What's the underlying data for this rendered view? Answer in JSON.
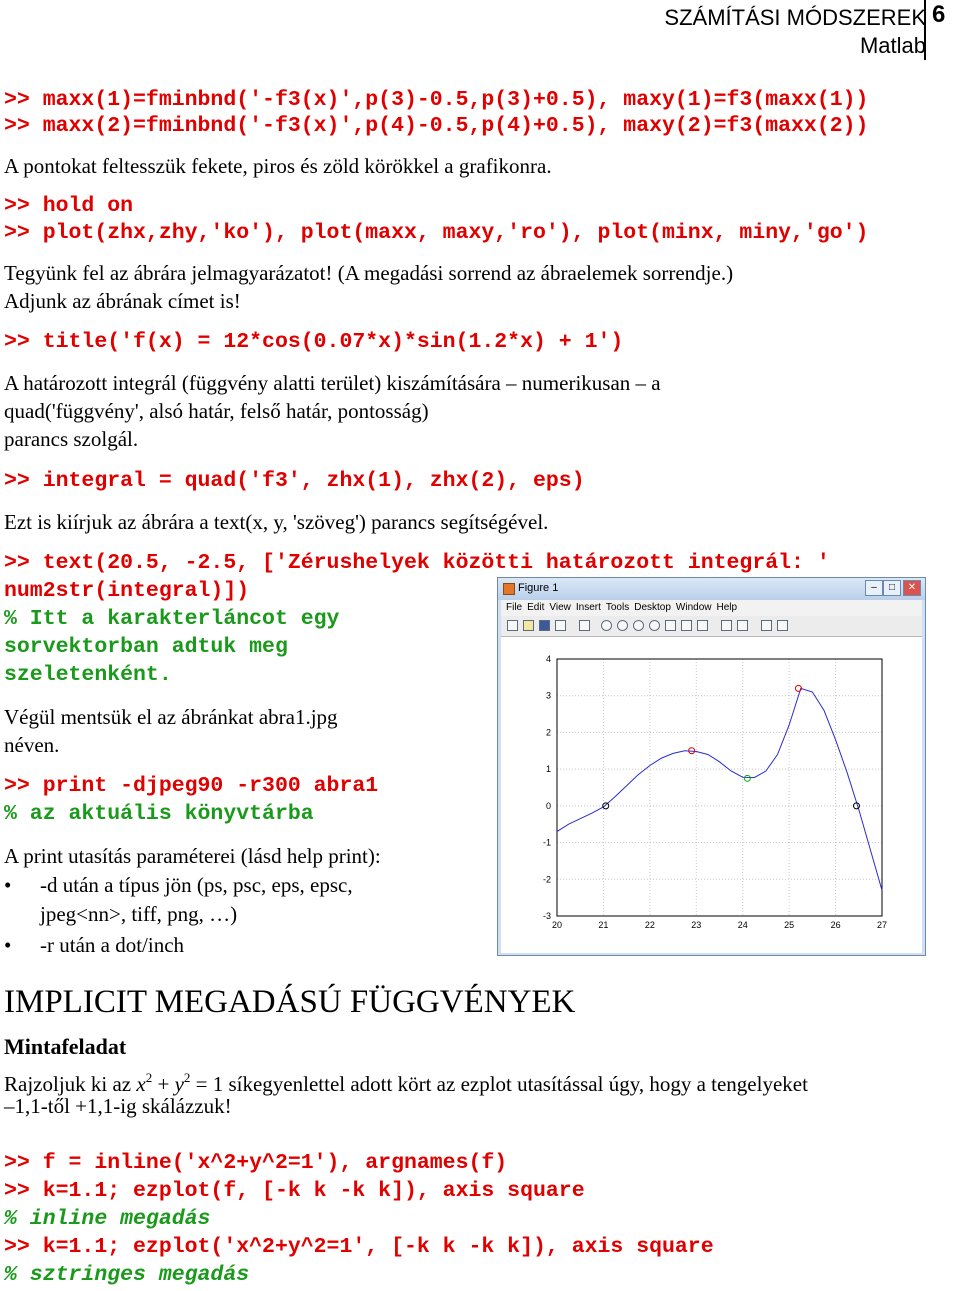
{
  "header": {
    "title": "SZÁMÍTÁSI MÓDSZEREK",
    "subtitle": "Matlab",
    "page_number": "6"
  },
  "lines": {
    "code1": ">> maxx(1)=fminbnd('-f3(x)',p(3)-0.5,p(3)+0.5), maxy(1)=f3(maxx(1))",
    "code2": ">> maxx(2)=fminbnd('-f3(x)',p(4)-0.5,p(4)+0.5), maxy(2)=f3(maxx(2))",
    "text1": "A pontokat feltesszük fekete, piros és zöld körökkel a grafikonra.",
    "code3": ">> hold on",
    "code4": ">> plot(zhx,zhy,'ko'), plot(maxx, maxy,'ro'), plot(minx, miny,'go')",
    "text2": "Tegyünk fel az ábrára jelmagyarázatot! (A megadási sorrend az ábraelemek sorrendje.)",
    "text3": "Adjunk az ábrának címet is!",
    "code5": ">> title('f(x) = 12*cos(0.07*x)*sin(1.2*x) + 1')",
    "text4": "A határozott integrál (függvény alatti terület) kiszámítására – numerikusan – a",
    "text5": "quad('függvény', alsó határ, felső határ, pontosság)",
    "text6": "parancs szolgál.",
    "code6": ">> integral = quad('f3', zhx(1), zhx(2), eps)",
    "text7": "Ezt is kiírjuk az ábrára a text(x, y, 'szöveg') parancs segítségével.",
    "code7": ">> text(20.5, -2.5, ['Zérushelyek közötti határozott integrál: '",
    "code8": "num2str(integral)])",
    "cmt1": "% Itt a karakterláncot egy",
    "cmt2": "sorvektorban adtuk meg",
    "cmt3": "szeletenként.",
    "text8": "Végül mentsük el az ábránkat abra1.jpg",
    "text9": "néven.",
    "code9": ">> print -djpeg90 -r300 abra1",
    "cmt4": "% az aktuális könyvtárba",
    "text10": "A print utasítás paraméterei (lásd help print):",
    "bullet1a": "-d után a típus jön (ps, psc, eps, epsc,",
    "bullet1b": "jpeg<nn>, tiff, png, …)",
    "bullet2": "-r után a dot/inch",
    "bullet_char": "•",
    "heading": "IMPLICIT MEGADÁSÚ FÜGGVÉNYEK",
    "subheading": "Mintafeladat",
    "task_a": "Rajzoljuk ki az ",
    "task_x": "x",
    "task_sup1": "2",
    "task_plus": " + ",
    "task_y": "y",
    "task_sup2": "2",
    "task_b": " = 1 síkegyenlettel adott kört az ezplot utasítással úgy, hogy a tengelyeket",
    "task2": "–1,1-től +1,1-ig skálázzuk!",
    "code10": ">> f = inline('x^2+y^2=1'), argnames(f)",
    "code11": ">> k=1.1; ezplot(f, [-k k -k k]), axis square",
    "cmt5": "% inline megadás",
    "code12": ">> k=1.1; ezplot('x^2+y^2=1', [-k k -k k]), axis square",
    "cmt6": "% sztringes megadás"
  },
  "figure": {
    "window_title": "Figure 1",
    "menu": [
      "File",
      "Edit",
      "View",
      "Insert",
      "Tools",
      "Desktop",
      "Window",
      "Help"
    ],
    "buttons": {
      "min": "–",
      "max": "□",
      "close": "✕"
    },
    "colors": {
      "curve": "#2b2bd0",
      "zero": "#000000",
      "max": "#e00000",
      "min": "#00b000"
    }
  },
  "chart_data": {
    "type": "line",
    "function": "f(x) = 12*cos(0.07*x)*sin(1.2*x) + 1",
    "xlim": [
      20,
      27
    ],
    "ylim": [
      -3,
      4
    ],
    "xticks": [
      20,
      21,
      22,
      23,
      24,
      25,
      26,
      27
    ],
    "yticks": [
      -3,
      -2,
      -1,
      0,
      1,
      2,
      3,
      4
    ],
    "grid": "dotted",
    "markers": {
      "zeros": [
        [
          21.05,
          0
        ],
        [
          26.45,
          0
        ]
      ],
      "maxima": [
        [
          22.9,
          1.5
        ],
        [
          25.2,
          3.2
        ]
      ],
      "minima": [
        [
          24.1,
          0.75
        ]
      ]
    },
    "curve": [
      [
        20.0,
        -0.7
      ],
      [
        20.25,
        -0.5
      ],
      [
        20.5,
        -0.35
      ],
      [
        20.75,
        -0.2
      ],
      [
        21.0,
        -0.03
      ],
      [
        21.25,
        0.25
      ],
      [
        21.5,
        0.55
      ],
      [
        21.75,
        0.85
      ],
      [
        22.0,
        1.1
      ],
      [
        22.25,
        1.3
      ],
      [
        22.5,
        1.43
      ],
      [
        22.75,
        1.5
      ],
      [
        23.0,
        1.48
      ],
      [
        23.25,
        1.4
      ],
      [
        23.5,
        1.2
      ],
      [
        23.75,
        0.95
      ],
      [
        24.0,
        0.78
      ],
      [
        24.25,
        0.77
      ],
      [
        24.5,
        0.95
      ],
      [
        24.75,
        1.4
      ],
      [
        25.0,
        2.2
      ],
      [
        25.25,
        3.2
      ],
      [
        25.5,
        3.1
      ],
      [
        25.75,
        2.6
      ],
      [
        26.0,
        1.8
      ],
      [
        26.25,
        0.9
      ],
      [
        26.5,
        -0.1
      ],
      [
        26.75,
        -1.2
      ],
      [
        27.0,
        -2.3
      ]
    ]
  }
}
